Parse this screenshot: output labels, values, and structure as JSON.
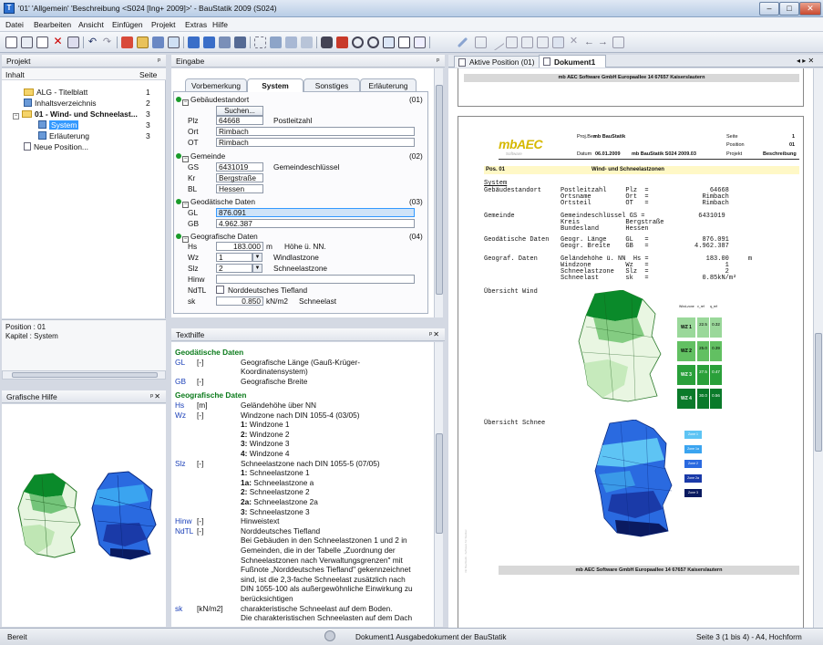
{
  "window": {
    "title": "'01' 'Allgemein' 'Beschreibung <S024 [Ing+ 2009]>' - BauStatik 2009 (S024)",
    "app_icon": "T"
  },
  "menu": [
    "Datei",
    "Bearbeiten",
    "Ansicht",
    "Einfügen",
    "Projekt",
    "Extras",
    "Hilfe"
  ],
  "project_panel": {
    "title": "Projekt",
    "col_content": "Inhalt",
    "col_page": "Seite",
    "items": [
      {
        "label": "ALG - Titelblatt",
        "page": "1",
        "icon": "folder-icon"
      },
      {
        "label": "Inhaltsverzeichnis",
        "page": "2",
        "icon": "sheet-icon"
      },
      {
        "label": "01 - Wind- und Schneelast...",
        "page": "3",
        "icon": "folder-icon"
      },
      {
        "label": "System",
        "page": "3",
        "icon": "sheet-icon"
      },
      {
        "label": "Erläuterung",
        "page": "3",
        "icon": "sheet-icon"
      },
      {
        "label": "Neue Position...",
        "page": "",
        "icon": "doc-icon"
      }
    ],
    "info_position": "Position : 01",
    "info_chapter": "Kapitel : System"
  },
  "grafische_hilfe": {
    "title": "Grafische Hilfe"
  },
  "eingabe": {
    "title": "Eingabe",
    "tabs": [
      "Vorbemerkung",
      "System",
      "Sonstiges",
      "Erläuterung"
    ],
    "active_tab": "System",
    "sections": {
      "gebaeude": {
        "title": "Gebäudestandort",
        "num": "(01)",
        "search_btn": "Suchen...",
        "plz_label": "Plz",
        "plz": "64668",
        "plz_desc": "Postleitzahl",
        "ort_label": "Ort",
        "ort": "Rimbach",
        "ot_label": "OT",
        "ot": "Rimbach"
      },
      "gemeinde": {
        "title": "Gemeinde",
        "num": "(02)",
        "gs_label": "GS",
        "gs": "6431019",
        "gs_desc": "Gemeindeschlüssel",
        "kr_label": "Kr",
        "kr": "Bergstraße",
        "bl_label": "BL",
        "bl": "Hessen"
      },
      "geodaet": {
        "title": "Geodätische Daten",
        "num": "(03)",
        "gl_label": "GL",
        "gl": "876.091",
        "gb_label": "GB",
        "gb": "4.962.387"
      },
      "geograf": {
        "title": "Geografische Daten",
        "num": "(04)",
        "hs_label": "Hs",
        "hs": "183.000",
        "hs_unit": "m",
        "hs_desc": "Höhe ü. NN.",
        "wz_label": "Wz",
        "wz": "1",
        "wz_desc": "Windlastzone",
        "slz_label": "Slz",
        "slz": "2",
        "slz_desc": "Schneelastzone",
        "hinw_label": "Hinw",
        "ndtl_label": "NdTL",
        "ndtl_desc": "Norddeutsches Tiefland",
        "sk_label": "sk",
        "sk": "0.850",
        "sk_unit": "kN/m2",
        "sk_desc": "Schneelast"
      }
    }
  },
  "texthilfe": {
    "title": "Texthilfe",
    "lines": [
      {
        "k": "Geodätische Daten",
        "c": "g"
      },
      {
        "k": "GL",
        "u": "[-]",
        "d": "Geografische Länge (Gauß-Krüger-"
      },
      {
        "k": "",
        "u": "",
        "d": "Koordinatensystem)"
      },
      {
        "k": "GB",
        "u": "[-]",
        "d": "Geografische Breite"
      },
      {
        "k": "Geografische Daten",
        "c": "g"
      },
      {
        "k": "Hs",
        "u": "[m]",
        "d": "Geländehöhe über NN"
      },
      {
        "k": "Wz",
        "u": "[-]",
        "d": "Windzone nach DIN 1055-4 (03/05)"
      },
      {
        "k": "",
        "u": "",
        "d": "1: Windzone 1"
      },
      {
        "k": "",
        "u": "",
        "d": "2: Windzone 2"
      },
      {
        "k": "",
        "u": "",
        "d": "3: Windzone 3"
      },
      {
        "k": "",
        "u": "",
        "d": "4: Windzone 4"
      },
      {
        "k": "Slz",
        "u": "[-]",
        "d": "Schneelastzone nach DIN 1055-5 (07/05)"
      },
      {
        "k": "",
        "u": "",
        "d": "1: Schneelastzone 1"
      },
      {
        "k": "",
        "u": "",
        "d": "1a: Schneelastzone a"
      },
      {
        "k": "",
        "u": "",
        "d": "2: Schneelastzone 2"
      },
      {
        "k": "",
        "u": "",
        "d": "2a: Schneelastzone 2a"
      },
      {
        "k": "",
        "u": "",
        "d": "3: Schneelastzone 3"
      },
      {
        "k": "Hinw",
        "u": "[-]",
        "d": "Hinweistext"
      },
      {
        "k": "NdTL",
        "u": "[-]",
        "d": "Norddeutsches Tiefland"
      },
      {
        "k": "",
        "u": "",
        "d": "Bei Gebäuden in den Schneelastzonen 1 und 2 in"
      },
      {
        "k": "",
        "u": "",
        "d": "Gemeinden, die in der Tabelle „Zuordnung der"
      },
      {
        "k": "",
        "u": "",
        "d": "Schneelastzonen nach Verwaltungsgrenzen\" mit"
      },
      {
        "k": "",
        "u": "",
        "d": "Fußnote „Norddeutsches Tiefland\" gekennzeichnet"
      },
      {
        "k": "",
        "u": "",
        "d": "sind, ist die 2,3-fache Schneelast zusätzlich nach"
      },
      {
        "k": "",
        "u": "",
        "d": "DIN 1055-100 als außergewöhnliche Einwirkung zu"
      },
      {
        "k": "",
        "u": "",
        "d": "berücksichtigen"
      },
      {
        "k": "sk",
        "u": "[kN/m2]",
        "d": "charakteristische Schneelast auf dem Boden."
      },
      {
        "k": "",
        "u": "",
        "d": "Die charakteristischen Schneelasten auf dem Dach"
      }
    ]
  },
  "doc_tabs": {
    "tab1": "Aktive Position (01)",
    "tab2": "Dokument1"
  },
  "document": {
    "top_footer": "mb AEC Software GmbH   Europaallee 14   67657 Kaiserslautern",
    "logo": "mbAEC",
    "logo_sub": "Software",
    "hdr_projbez": "Proj.Bez",
    "hdr_proj_name": "mb BauStatik",
    "hdr_datum_lbl": "Datum",
    "hdr_datum": "06.01.2009",
    "hdr_program": "mb BauStatik S024  2009.03",
    "hdr_seite_lbl": "Seite",
    "hdr_seite": "1",
    "hdr_position_lbl": "Position",
    "hdr_position": "01",
    "hdr_projekt_lbl": "Projekt",
    "hdr_projekt": "Beschreibung",
    "pos_label": "Pos. 01",
    "pos_title": "Wind- und Schneelastzonen",
    "system_title": "System",
    "block1": "Gebäudestandort     Postleitzahl     Plz  =                64668\n                    Ortsname         Ort  =              Rimbach\n                    Ortsteil         OT   =              Rimbach",
    "block2": "Gemeinde            Gemeindeschlüssel GS =              6431019\n                    Kreis            Bergstraße\n                    Bundesland       Hessen",
    "block3": "Geodätische Daten   Geogr. Länge     GL   =              876.091\n                    Geogr. Breite    GB   =            4.962.387",
    "block4": "Geograf. Daten      Geländehöhe ü. NN  Hs =               183.00     m\n                    Windzone         Wz   =                    1\n                    Schneelastzone   Slz  =                    2\n                    Schneelast       sk   =              0.85kN/m²",
    "wind_title": "Übersicht Wind",
    "snow_title": "Übersicht Schnee",
    "wind_table_head": [
      "Wind-zone",
      "v_ref",
      "q_ref"
    ],
    "wind_table": [
      {
        "zone": "WZ 1",
        "v": "22.5",
        "q": "0.32"
      },
      {
        "zone": "WZ 2",
        "v": "25.0",
        "q": "0.39"
      },
      {
        "zone": "WZ 3",
        "v": "27.5",
        "q": "0.47"
      },
      {
        "zone": "WZ 4",
        "v": "30.0",
        "q": "0.56"
      }
    ],
    "snow_legend": [
      "Zone 1",
      "Zone 1a",
      "Zone 2",
      "Zone 2a",
      "Zone 3"
    ],
    "bottom_footer": "mb AEC Software GmbH   Europaallee 14   67657 Kaiserslautern",
    "side_text": "mb BauStatik - Software für Statiker"
  },
  "status": {
    "left": "Bereit",
    "mid": "Dokument1  Ausgabedokument der BauStatik",
    "right": "Seite 3 (1 bis 4) - A4, Hochform"
  },
  "colors": {
    "accent": "#3399ff",
    "green_dot": "#1a9b2a",
    "help_green": "#0a7a1a",
    "help_blue": "#1a3fb8"
  }
}
